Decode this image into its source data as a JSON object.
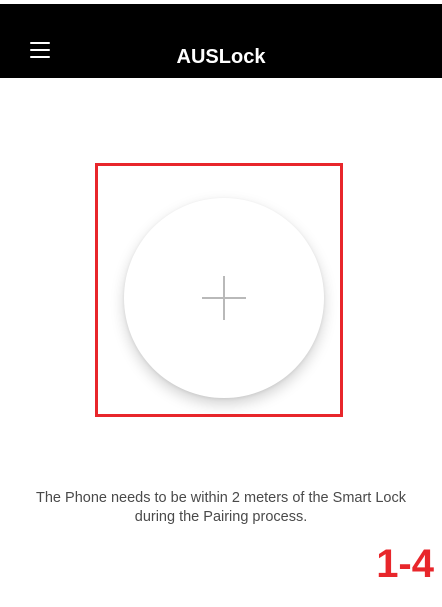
{
  "app_bar": {
    "title": "AUSLock",
    "menu_icon": "hamburger-menu-icon"
  },
  "main": {
    "add_icon": "plus-icon",
    "instruction": "The Phone needs to be within 2 meters of the Smart Lock during the Pairing process."
  },
  "annotation": {
    "step_label": "1-4"
  },
  "colors": {
    "app_bar_bg": "#000000",
    "highlight": "#e8262b",
    "plus": "#b9b9b9",
    "text": "#4a4a4a"
  }
}
